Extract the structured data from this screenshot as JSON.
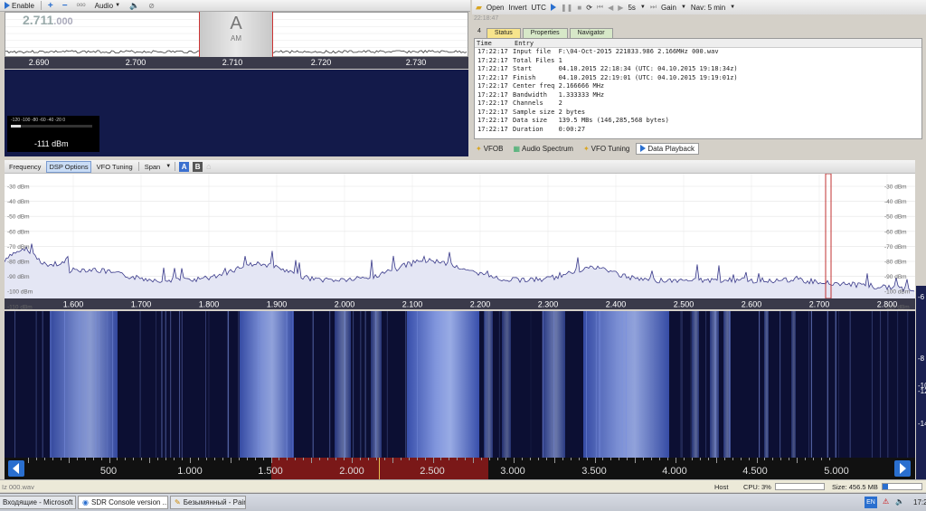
{
  "top_left_toolbar": {
    "enable_label": "Enable",
    "audio_label": "Audio",
    "speed_icon_label": "ooo"
  },
  "mini_spectrum": {
    "frequency_main": "2.711",
    "frequency_suffix": ".000",
    "mode_letter": "A",
    "mode_label": "AM",
    "axis_ticks": [
      "2.690",
      "2.700",
      "2.710",
      "2.720",
      "2.730"
    ]
  },
  "smeter": {
    "value": "-111 dBm",
    "level_fraction": 0.12
  },
  "right_toolbar": {
    "open_label": "Open",
    "invert_label": "Invert",
    "utc_label": "UTC",
    "speed_label": "5s",
    "gain_label": "Gain",
    "nav_label": "Nav: 5 min",
    "time_display": "22:18:47"
  },
  "status_tabs": [
    "Status",
    "Properties",
    "Navigator"
  ],
  "status_table": {
    "headers": [
      "Time",
      "Entry"
    ],
    "rows": [
      {
        "time": "17:22:17",
        "entry": "Input file  F:\\04-Oct-2015 221833.986 2.166MHz 000.wav"
      },
      {
        "time": "17:22:17",
        "entry": "Total Files 1"
      },
      {
        "time": "17:22:17",
        "entry": "Start       04.10.2015 22:18:34 (UTC: 04.10.2015 19:18:34z)"
      },
      {
        "time": "17:22:17",
        "entry": "Finish      04.10.2015 22:19:01 (UTC: 04.10.2015 19:19:01z)"
      },
      {
        "time": "17:22:17",
        "entry": "Center freq 2.166666 MHz"
      },
      {
        "time": "17:22:17",
        "entry": "Bandwidth   1.333333 MHz"
      },
      {
        "time": "17:22:17",
        "entry": "Channels    2"
      },
      {
        "time": "17:22:17",
        "entry": "Sample size 2 bytes"
      },
      {
        "time": "17:22:17",
        "entry": "Data size   139.5 MBs (146,285,568 bytes)"
      },
      {
        "time": "17:22:17",
        "entry": "Duration    0:00:27"
      }
    ]
  },
  "bottom_tabs": [
    "VFOB",
    "Audio Spectrum",
    "VFO Tuning",
    "Data Playback"
  ],
  "main_toolbar": {
    "items": [
      "Frequency",
      "DSP Options",
      "VFO Tuning",
      "Span"
    ],
    "a_label": "A",
    "b_label": "B"
  },
  "spectrum": {
    "db_labels": [
      "-30 dBm",
      "-40 dBm",
      "-50 dBm",
      "-60 dBm",
      "-70 dBm",
      "-80 dBm",
      "-90 dBm",
      "-100 dBm",
      "-110 dBm"
    ],
    "freq_ticks": [
      "1.600",
      "1.700",
      "1.800",
      "1.900",
      "2.000",
      "2.100",
      "2.200",
      "2.300",
      "2.400",
      "2.500",
      "2.600",
      "2.700",
      "2.800"
    ]
  },
  "scale_bar": {
    "labels": [
      "500",
      "1.000",
      "1.500",
      "2.000",
      "2.500",
      "3.000",
      "3.500",
      "4.000",
      "4.500",
      "5.000"
    ]
  },
  "right_strip": {
    "labels": [
      "-6",
      "-8",
      "-10",
      "-12",
      "-14"
    ]
  },
  "statusbar": {
    "file_label": "Iz 000.wav",
    "host_label": "Host",
    "cpu_label": "CPU: 3%",
    "size_label": "Size: 456.5 MB"
  },
  "taskbar": {
    "tasks": [
      "Входящие - Microsoft O...",
      "SDR Console version ...",
      "Безымянный - Paint"
    ],
    "lang": "EN",
    "clock": "17:2"
  },
  "colors": {
    "waterfall_bg": "#0c0f33",
    "signal": "#6f8de0",
    "trace": "#3a3a8a",
    "marker": "#c03030"
  }
}
